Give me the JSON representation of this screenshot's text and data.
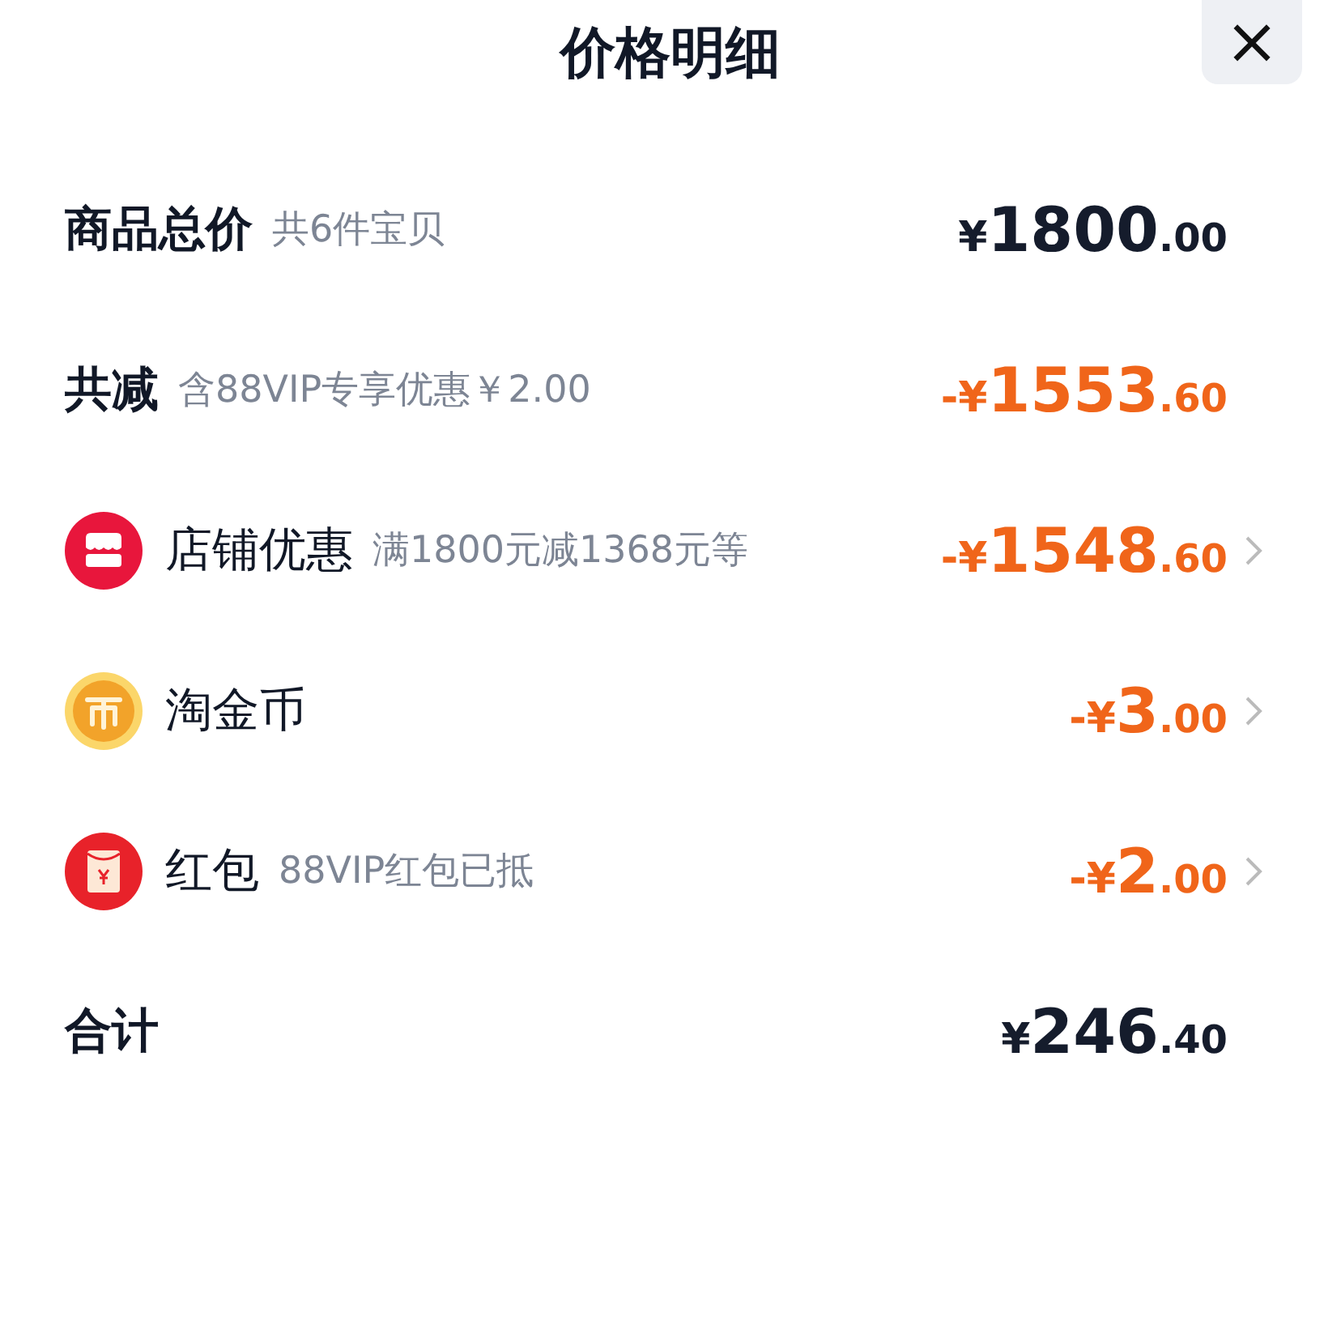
{
  "title": "价格明细",
  "close": "×",
  "rows": [
    {
      "kind": "summary",
      "label": "商品总价",
      "note": "共6件宝贝",
      "highlight": false,
      "amount": {
        "prefix": "¥",
        "integer": "1800",
        "fraction": ".00"
      }
    },
    {
      "kind": "summary",
      "label": "共减",
      "note": "含88VIP专享优惠￥2.00",
      "highlight": true,
      "amount": {
        "prefix": "-¥",
        "integer": "1553",
        "fraction": ".60"
      }
    },
    {
      "kind": "item",
      "label": "店铺优惠",
      "note": "满1800元减1368元等",
      "highlight": true,
      "amount": {
        "prefix": "-¥",
        "integer": "1548",
        "fraction": ".60"
      }
    },
    {
      "kind": "item",
      "label": "淘金币",
      "highlight": true,
      "amount": {
        "prefix": "-¥",
        "integer": "3",
        "fraction": ".00"
      }
    },
    {
      "kind": "item",
      "label": "红包",
      "note": "88VIP红包已抵",
      "highlight": true,
      "amount": {
        "prefix": "-¥",
        "integer": "2",
        "fraction": ".00"
      }
    },
    {
      "kind": "summary",
      "label": "合计",
      "highlight": false,
      "amount": {
        "prefix": "¥",
        "integer": "246",
        "fraction": ".40"
      }
    }
  ]
}
